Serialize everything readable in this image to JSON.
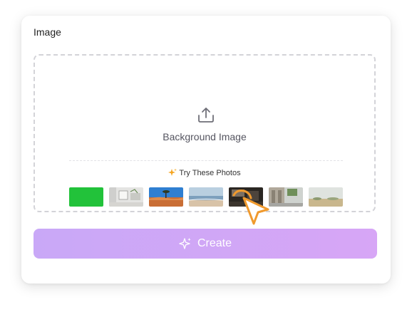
{
  "panel": {
    "title": "Image"
  },
  "dropzone": {
    "upload_icon": "upload-icon",
    "label": "Background Image"
  },
  "suggestions": {
    "label": "Try These Photos",
    "icon": "sparkle-icon",
    "accent": "#f5a623",
    "photos": [
      {
        "name": "green-screen"
      },
      {
        "name": "white-room"
      },
      {
        "name": "desert-tree"
      },
      {
        "name": "beach"
      },
      {
        "name": "dark-interior"
      },
      {
        "name": "street-arcade"
      },
      {
        "name": "field"
      }
    ]
  },
  "actions": {
    "create_label": "Create",
    "create_icon": "sparkle-icon",
    "create_color": "#cfa7f7"
  },
  "cursor": {
    "icon": "pointer-arrow-icon",
    "color": "#f09a2e"
  }
}
